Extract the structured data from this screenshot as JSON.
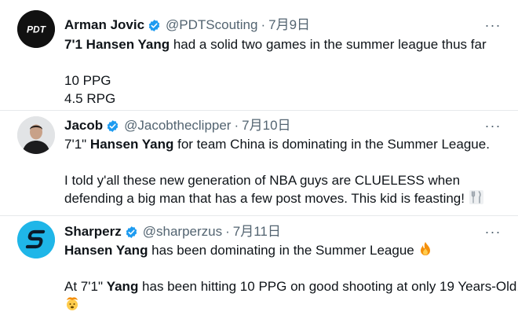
{
  "tweets": [
    {
      "name": "Arman Jovic",
      "handle": "@PDTScouting",
      "separator": "·",
      "date": "7月9日",
      "more": "···",
      "avatar_text": "PDT",
      "body": {
        "l1_bold": "7'1 Hansen Yang",
        "l1_rest": " had a solid two games in the summer league thus far",
        "l2": "10 PPG",
        "l3": "4.5 RPG"
      }
    },
    {
      "name": "Jacob",
      "handle": "@Jacobtheclipper",
      "separator": "·",
      "date": "7月10日",
      "more": "···",
      "body": {
        "l1_pre": "7'1\" ",
        "l1_bold": "Hansen Yang",
        "l1_rest": " for team China is dominating in the Summer League.",
        "l2": "I told y'all these new generation of NBA guys are CLUELESS when",
        "l3": "defending a big man that has a few post moves. This kid is feasting!"
      },
      "emoji": "fork-and-knife-icon"
    },
    {
      "name": "Sharperz",
      "handle": "@sharperzus",
      "separator": "·",
      "date": "7月11日",
      "more": "···",
      "body": {
        "l1_bold": "Hansen Yang",
        "l1_rest": " has been dominating in the Summer League",
        "l2_pre": "At 7'1\" ",
        "l2_bold": "Yang",
        "l2_rest": " has been hitting 10 PPG on good shooting at only 19 Years-Old."
      },
      "emojis": [
        "fire-icon",
        "exploding-head-icon"
      ]
    }
  ],
  "colors": {
    "text": "#0f1419",
    "secondary": "#536471",
    "verified": "#1d9bf0",
    "divider": "#e6e9eb",
    "sharperz_avatar": "#1fb6e8"
  }
}
